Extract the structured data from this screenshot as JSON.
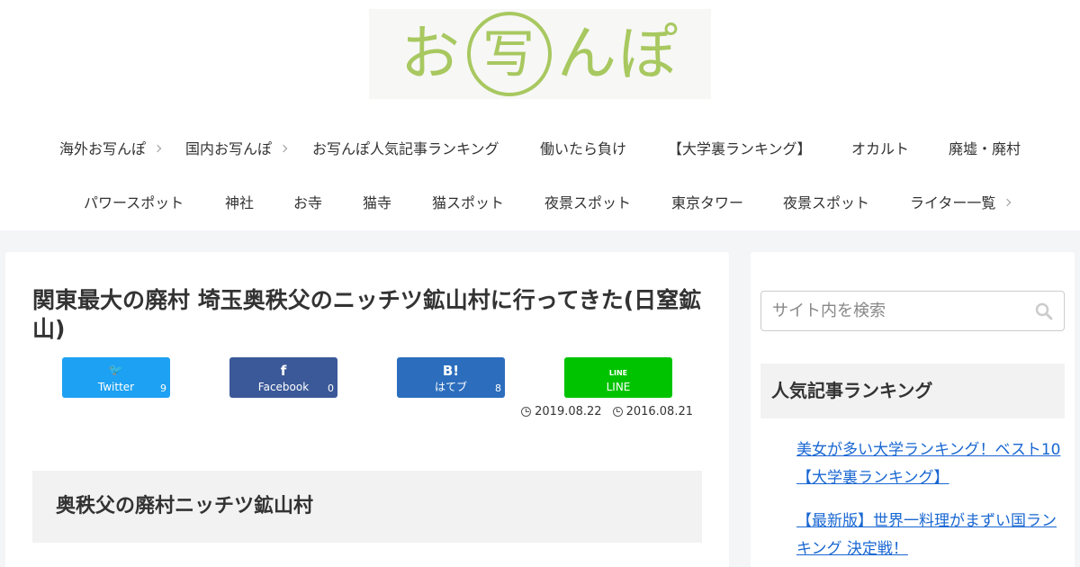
{
  "logo": {
    "part1": "お",
    "part2": "写",
    "part3": "んぽ"
  },
  "nav": {
    "row1": [
      {
        "label": "海外お写んぽ",
        "dropdown": true
      },
      {
        "label": "国内お写んぽ",
        "dropdown": true
      },
      {
        "label": "お写んぽ人気記事ランキング",
        "dropdown": false
      },
      {
        "label": "働いたら負け",
        "dropdown": false
      },
      {
        "label": "【大学裏ランキング】",
        "dropdown": false
      },
      {
        "label": "オカルト",
        "dropdown": false
      },
      {
        "label": "廃墟・廃村",
        "dropdown": false
      }
    ],
    "row2": [
      {
        "label": "パワースポット",
        "dropdown": false
      },
      {
        "label": "神社",
        "dropdown": false
      },
      {
        "label": "お寺",
        "dropdown": false
      },
      {
        "label": "猫寺",
        "dropdown": false
      },
      {
        "label": "猫スポット",
        "dropdown": false
      },
      {
        "label": "夜景スポット",
        "dropdown": false
      },
      {
        "label": "東京タワー",
        "dropdown": false
      },
      {
        "label": "夜景スポット",
        "dropdown": false
      },
      {
        "label": "ライター一覧",
        "dropdown": true
      }
    ]
  },
  "article": {
    "title": "関東最大の廃村 埼玉奥秩父のニッチツ鉱山村に行ってきた(日窒鉱山)",
    "updated": "2019.08.22",
    "published": "2016.08.21",
    "section_heading": "奥秩父の廃村ニッチツ鉱山村"
  },
  "share": [
    {
      "label": "Twitter",
      "icon": "twitter-bird-icon",
      "glyph": "🐦",
      "count": "9",
      "color": "#1da1f2"
    },
    {
      "label": "Facebook",
      "icon": "facebook-icon",
      "glyph": "f",
      "count": "0",
      "color": "#3b5998"
    },
    {
      "label": "はてブ",
      "icon": "hatena-bookmark-icon",
      "glyph": "B!",
      "count": "8",
      "color": "#2c6ebd"
    },
    {
      "label": "LINE",
      "icon": "line-icon",
      "glyph": "LINE",
      "count": "",
      "color": "#00c300"
    }
  ],
  "sidebar": {
    "search_placeholder": "サイト内を検索",
    "ranking_title": "人気記事ランキング",
    "ranking": [
      "美女が多い大学ランキング！ベスト10【大学裏ランキング】",
      "【最新版】世界一料理がまずい国ランキング 決定戦！"
    ]
  },
  "colors": {
    "logo": "#a8c860",
    "link": "#1967d2",
    "background": "#f4f5f7"
  }
}
